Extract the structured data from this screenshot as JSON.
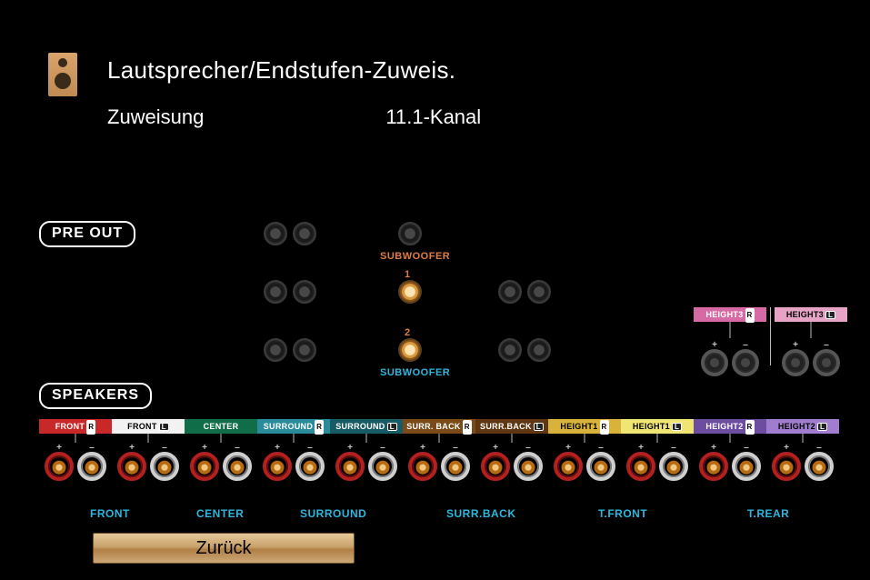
{
  "header": {
    "title": "Lautsprecher/Endstufen-Zuweis.",
    "assignment_label": "Zuweisung",
    "assignment_value": "11.1-Kanal"
  },
  "sections": {
    "preout_label": "PRE OUT",
    "speakers_label": "SPEAKERS"
  },
  "preout": {
    "subwoofer_label_top": "SUBWOOFER",
    "subwoofer_label_bottom": "SUBWOOFER",
    "sub1_num": "1",
    "sub2_num": "2"
  },
  "speaker_tags": [
    {
      "text": "FRONT",
      "side": "R",
      "color": "c-red"
    },
    {
      "text": "FRONT",
      "side": "L",
      "color": "c-white"
    },
    {
      "text": "CENTER",
      "side": "",
      "color": "c-green"
    },
    {
      "text": "SURROUND",
      "side": "R",
      "color": "c-teal"
    },
    {
      "text": "SURROUND",
      "side": "L",
      "color": "c-dteal"
    },
    {
      "text": "SURR. BACK",
      "side": "R",
      "color": "c-brown"
    },
    {
      "text": "SURR.BACK",
      "side": "L",
      "color": "c-dbrown"
    },
    {
      "text": "HEIGHT1",
      "side": "R",
      "color": "c-gold"
    },
    {
      "text": "HEIGHT1",
      "side": "L",
      "color": "c-lemon"
    },
    {
      "text": "HEIGHT2",
      "side": "R",
      "color": "c-purple"
    },
    {
      "text": "HEIGHT2",
      "side": "L",
      "color": "c-lilac"
    }
  ],
  "height3_tags": [
    {
      "text": "HEIGHT3",
      "side": "R",
      "color": "c-pink"
    },
    {
      "text": "HEIGHT3",
      "side": "L",
      "color": "c-lpink"
    }
  ],
  "group_captions": {
    "front": "FRONT",
    "center": "CENTER",
    "surround": "SURROUND",
    "surrback": "SURR.BACK",
    "tfront": "T.FRONT",
    "trear": "T.REAR"
  },
  "polarity": {
    "plus": "+",
    "minus": "–"
  },
  "buttons": {
    "back": "Zurück"
  }
}
